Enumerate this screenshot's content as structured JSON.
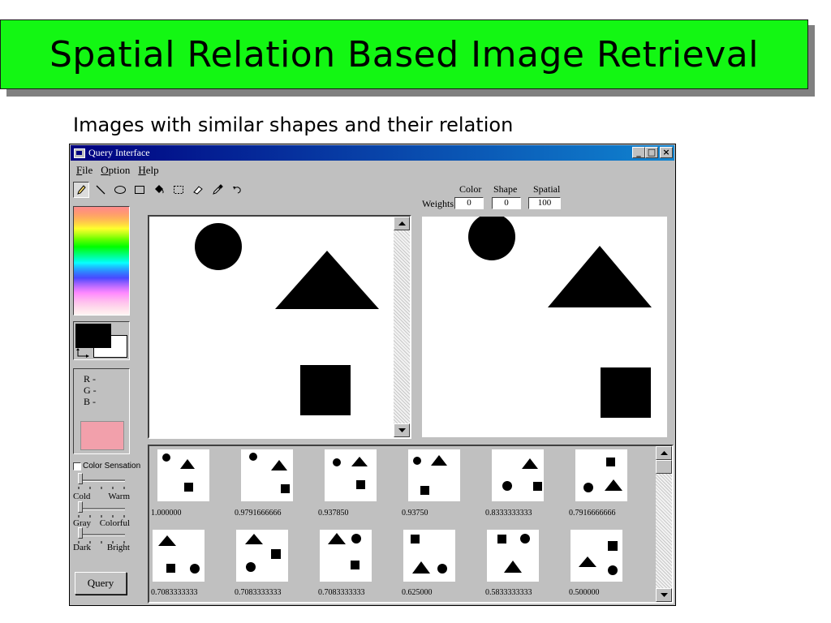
{
  "slide": {
    "title": "Spatial Relation Based Image Retrieval",
    "subtitle": "Images with similar shapes and their relation"
  },
  "window": {
    "title": "Query Interface",
    "controls": [
      "_",
      "□",
      "×"
    ],
    "menu": [
      {
        "underline": "F",
        "rest": "ile"
      },
      {
        "underline": "O",
        "rest": "ption"
      },
      {
        "underline": "H",
        "rest": "elp"
      }
    ],
    "tools": [
      "pencil-icon",
      "line-icon",
      "ellipse-icon",
      "rectangle-icon",
      "fill-bucket-icon",
      "select-rectangle-icon",
      "eraser-icon",
      "eyedropper-icon",
      "undo-icon"
    ]
  },
  "weights": {
    "label": "Weights",
    "color_label": "Color",
    "shape_label": "Shape",
    "spatial_label": "Spatial",
    "color": "0",
    "shape": "0",
    "spatial": "100"
  },
  "color_info": {
    "r": "R -",
    "g": "G -",
    "b": "B -",
    "foreground": "#000000",
    "background": "#ffffff",
    "sample": "#f2a0ab"
  },
  "sensation": {
    "checkbox_label": "Color Sensation",
    "checked": false,
    "sliders": [
      {
        "left": "Cold",
        "right": "Warm",
        "value": 0
      },
      {
        "left": "Gray",
        "right": "Colorful",
        "value": 0
      },
      {
        "left": "Dark",
        "right": "Bright",
        "value": 0
      }
    ]
  },
  "query_button": "Query",
  "results": {
    "row1": [
      {
        "score": "1.000000"
      },
      {
        "score": "0.9791666666"
      },
      {
        "score": "0.937850"
      },
      {
        "score": "0.93750"
      },
      {
        "score": "0.8333333333"
      },
      {
        "score": "0.7916666666"
      }
    ],
    "row2": [
      {
        "score": "0.7083333333"
      },
      {
        "score": "0.7083333333"
      },
      {
        "score": "0.7083333333"
      },
      {
        "score": "0.625000"
      },
      {
        "score": "0.5833333333"
      },
      {
        "score": "0.500000"
      }
    ]
  },
  "colors": {
    "banner": "#13f713",
    "titlebar_start": "#000080",
    "titlebar_end": "#1084d0",
    "window_bg": "#c0c0c0"
  }
}
